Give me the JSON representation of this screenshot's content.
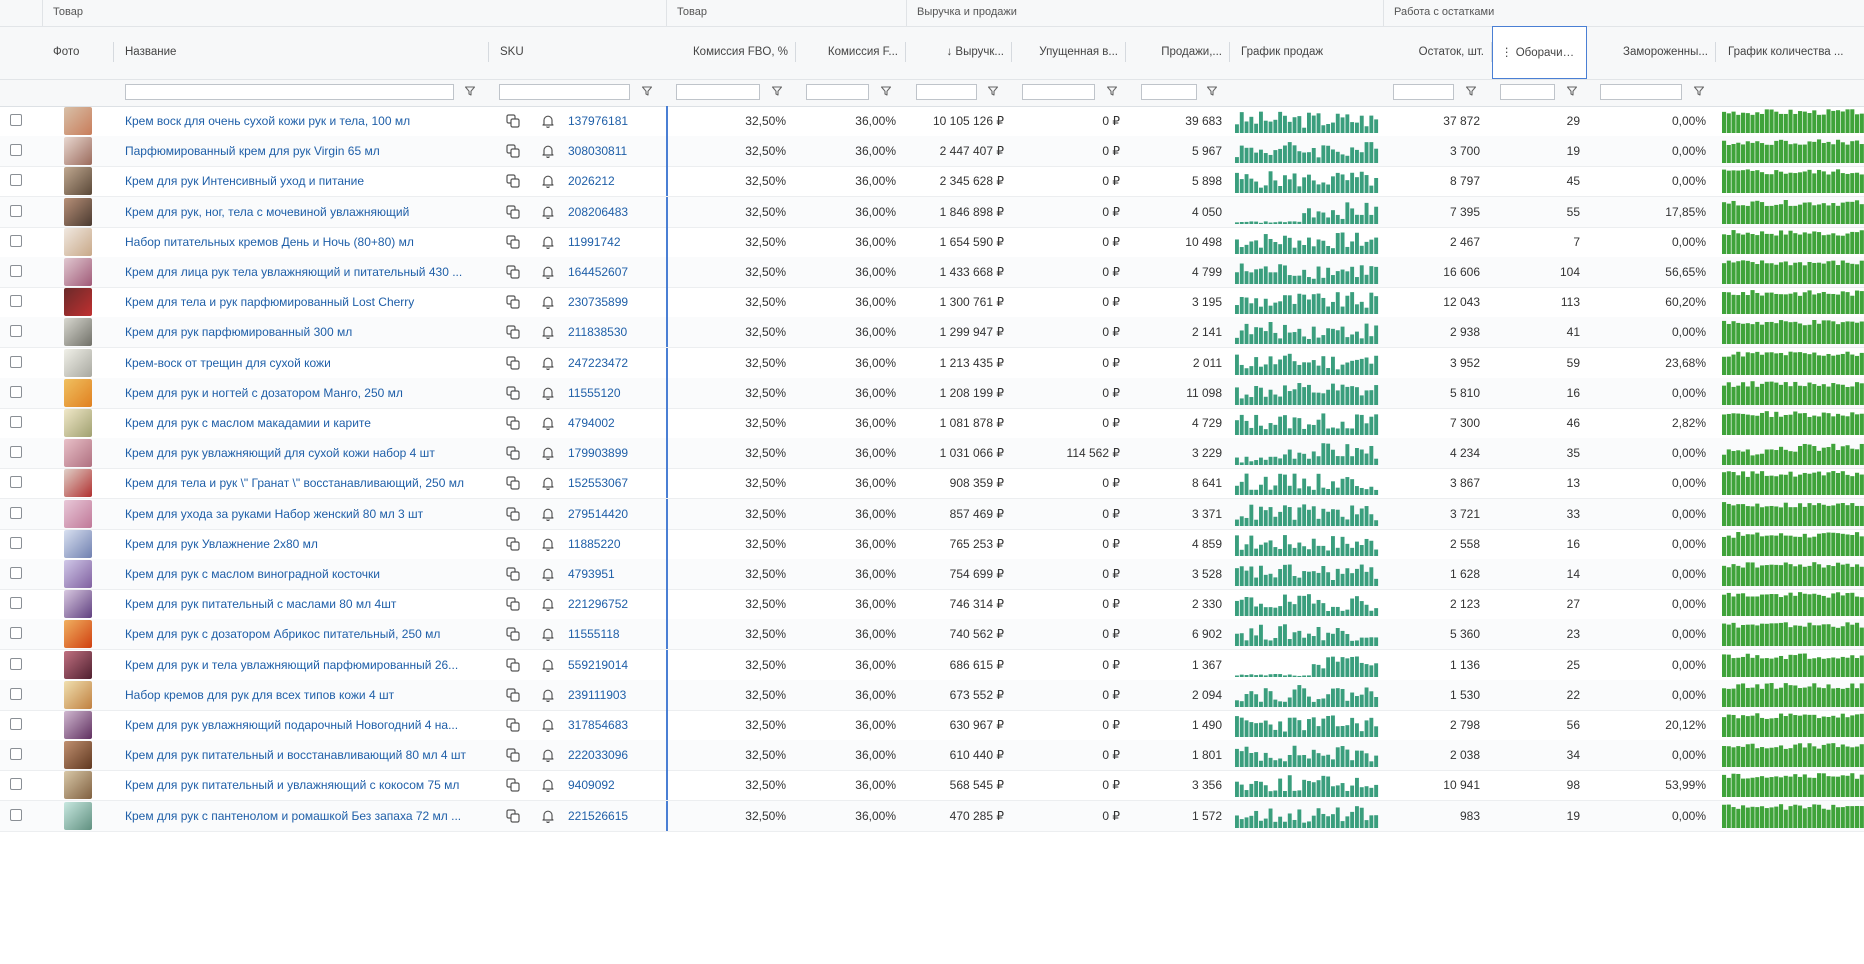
{
  "groups": [
    {
      "label": "Товар"
    },
    {
      "label": "Товар"
    },
    {
      "label": "Выручка и продажи"
    },
    {
      "label": "Работа с остатками"
    }
  ],
  "columns": {
    "photo": "Фото",
    "name": "Название",
    "sku": "SKU",
    "fbo": "Комиссия FBO, %",
    "fbs": "Комиссия F...",
    "revenue": "↓ Выручк...",
    "lost": "Упущенная в...",
    "sales": "Продажи,...",
    "sales_chart": "График продаж",
    "stock": "Остаток, шт.",
    "turnover": "⋮ Оборачив...",
    "frozen": "Замороженны...",
    "stock_chart": "График количества ..."
  },
  "colors": {
    "link": "#1f5fa8",
    "bar": "#3a9e7d",
    "stock_bar": "#3fa33a",
    "accent": "#4a7fd4"
  },
  "rows": [
    {
      "name": "Крем воск для очень сухой кожи рук и тела, 100 мл",
      "sku": "137976181",
      "fbo": "32,50%",
      "fbs": "36,00%",
      "revenue": "10 105 126 ₽",
      "lost": "0 ₽",
      "sales": "39 683",
      "stock": "37 872",
      "turnover": "29",
      "frozen": "0,00%"
    },
    {
      "name": "Парфюмированный крем для рук Virgin 65 мл",
      "sku": "308030811",
      "fbo": "32,50%",
      "fbs": "36,00%",
      "revenue": "2 447 407 ₽",
      "lost": "0 ₽",
      "sales": "5 967",
      "stock": "3 700",
      "turnover": "19",
      "frozen": "0,00%"
    },
    {
      "name": "Крем для рук Интенсивный уход и питание",
      "sku": "2026212",
      "fbo": "32,50%",
      "fbs": "36,00%",
      "revenue": "2 345 628 ₽",
      "lost": "0 ₽",
      "sales": "5 898",
      "stock": "8 797",
      "turnover": "45",
      "frozen": "0,00%"
    },
    {
      "name": "Крем для рук, ног, тела с мочевиной увлажняющий",
      "sku": "208206483",
      "fbo": "32,50%",
      "fbs": "36,00%",
      "revenue": "1 846 898 ₽",
      "lost": "0 ₽",
      "sales": "4 050",
      "stock": "7 395",
      "turnover": "55",
      "frozen": "17,85%"
    },
    {
      "name": "Набор питательных кремов День и Ночь (80+80) мл",
      "sku": "11991742",
      "fbo": "32,50%",
      "fbs": "36,00%",
      "revenue": "1 654 590 ₽",
      "lost": "0 ₽",
      "sales": "10 498",
      "stock": "2 467",
      "turnover": "7",
      "frozen": "0,00%"
    },
    {
      "name": "Крем для лица рук тела увлажняющий и питательный 430 ...",
      "sku": "164452607",
      "fbo": "32,50%",
      "fbs": "36,00%",
      "revenue": "1 433 668 ₽",
      "lost": "0 ₽",
      "sales": "4 799",
      "stock": "16 606",
      "turnover": "104",
      "frozen": "56,65%"
    },
    {
      "name": "Крем для тела и рук парфюмированный Lost Cherry",
      "sku": "230735899",
      "fbo": "32,50%",
      "fbs": "36,00%",
      "revenue": "1 300 761 ₽",
      "lost": "0 ₽",
      "sales": "3 195",
      "stock": "12 043",
      "turnover": "113",
      "frozen": "60,20%"
    },
    {
      "name": "Крем для рук парфюмированный 300 мл",
      "sku": "211838530",
      "fbo": "32,50%",
      "fbs": "36,00%",
      "revenue": "1 299 947 ₽",
      "lost": "0 ₽",
      "sales": "2 141",
      "stock": "2 938",
      "turnover": "41",
      "frozen": "0,00%"
    },
    {
      "name": "Крем-воск от трещин для сухой кожи",
      "sku": "247223472",
      "fbo": "32,50%",
      "fbs": "36,00%",
      "revenue": "1 213 435 ₽",
      "lost": "0 ₽",
      "sales": "2 011",
      "stock": "3 952",
      "turnover": "59",
      "frozen": "23,68%"
    },
    {
      "name": "Крем для рук и ногтей с дозатором Манго, 250 мл",
      "sku": "11555120",
      "fbo": "32,50%",
      "fbs": "36,00%",
      "revenue": "1 208 199 ₽",
      "lost": "0 ₽",
      "sales": "11 098",
      "stock": "5 810",
      "turnover": "16",
      "frozen": "0,00%"
    },
    {
      "name": "Крем для рук с маслом макадамии и карите",
      "sku": "4794002",
      "fbo": "32,50%",
      "fbs": "36,00%",
      "revenue": "1 081 878 ₽",
      "lost": "0 ₽",
      "sales": "4 729",
      "stock": "7 300",
      "turnover": "46",
      "frozen": "2,82%"
    },
    {
      "name": "Крем для рук увлажняющий для сухой кожи набор 4 шт",
      "sku": "179903899",
      "fbo": "32,50%",
      "fbs": "36,00%",
      "revenue": "1 031 066 ₽",
      "lost": "114 562 ₽",
      "sales": "3 229",
      "stock": "4 234",
      "turnover": "35",
      "frozen": "0,00%"
    },
    {
      "name": "Крем для тела и рук \\\" Гранат \\\" восстанавливающий, 250 мл",
      "sku": "152553067",
      "fbo": "32,50%",
      "fbs": "36,00%",
      "revenue": "908 359 ₽",
      "lost": "0 ₽",
      "sales": "8 641",
      "stock": "3 867",
      "turnover": "13",
      "frozen": "0,00%"
    },
    {
      "name": "Крем для ухода за руками Набор женский 80 мл 3 шт",
      "sku": "279514420",
      "fbo": "32,50%",
      "fbs": "36,00%",
      "revenue": "857 469 ₽",
      "lost": "0 ₽",
      "sales": "3 371",
      "stock": "3 721",
      "turnover": "33",
      "frozen": "0,00%"
    },
    {
      "name": "Крем для рук Увлажнение 2х80 мл",
      "sku": "11885220",
      "fbo": "32,50%",
      "fbs": "36,00%",
      "revenue": "765 253 ₽",
      "lost": "0 ₽",
      "sales": "4 859",
      "stock": "2 558",
      "turnover": "16",
      "frozen": "0,00%"
    },
    {
      "name": "Крем для рук с маслом виноградной косточки",
      "sku": "4793951",
      "fbo": "32,50%",
      "fbs": "36,00%",
      "revenue": "754 699 ₽",
      "lost": "0 ₽",
      "sales": "3 528",
      "stock": "1 628",
      "turnover": "14",
      "frozen": "0,00%"
    },
    {
      "name": "Крем для рук питательный с маслами 80 мл 4шт",
      "sku": "221296752",
      "fbo": "32,50%",
      "fbs": "36,00%",
      "revenue": "746 314 ₽",
      "lost": "0 ₽",
      "sales": "2 330",
      "stock": "2 123",
      "turnover": "27",
      "frozen": "0,00%"
    },
    {
      "name": "Крем для рук с дозатором Абрикос питательный, 250 мл",
      "sku": "11555118",
      "fbo": "32,50%",
      "fbs": "36,00%",
      "revenue": "740 562 ₽",
      "lost": "0 ₽",
      "sales": "6 902",
      "stock": "5 360",
      "turnover": "23",
      "frozen": "0,00%"
    },
    {
      "name": "Крем для рук и тела увлажняющий парфюмированный 26...",
      "sku": "559219014",
      "fbo": "32,50%",
      "fbs": "36,00%",
      "revenue": "686 615 ₽",
      "lost": "0 ₽",
      "sales": "1 367",
      "stock": "1 136",
      "turnover": "25",
      "frozen": "0,00%"
    },
    {
      "name": "Набор кремов для рук для всех типов кожи 4 шт",
      "sku": "239111903",
      "fbo": "32,50%",
      "fbs": "36,00%",
      "revenue": "673 552 ₽",
      "lost": "0 ₽",
      "sales": "2 094",
      "stock": "1 530",
      "turnover": "22",
      "frozen": "0,00%"
    },
    {
      "name": "Крем для рук увлажняющий подарочный Новогодний 4 на...",
      "sku": "317854683",
      "fbo": "32,50%",
      "fbs": "36,00%",
      "revenue": "630 967 ₽",
      "lost": "0 ₽",
      "sales": "1 490",
      "stock": "2 798",
      "turnover": "56",
      "frozen": "20,12%"
    },
    {
      "name": "Крем для рук питательный и восстанавливающий 80 мл 4 шт",
      "sku": "222033096",
      "fbo": "32,50%",
      "fbs": "36,00%",
      "revenue": "610 440 ₽",
      "lost": "0 ₽",
      "sales": "1 801",
      "stock": "2 038",
      "turnover": "34",
      "frozen": "0,00%"
    },
    {
      "name": "Крем для рук питательный и увлажняющий с кокосом 75 мл",
      "sku": "9409092",
      "fbo": "32,50%",
      "fbs": "36,00%",
      "revenue": "568 545 ₽",
      "lost": "0 ₽",
      "sales": "3 356",
      "stock": "10 941",
      "turnover": "98",
      "frozen": "53,99%"
    },
    {
      "name": "Крем для рук с пантенолом и ромашкой Без запаха 72 мл ...",
      "sku": "221526615",
      "fbo": "32,50%",
      "fbs": "36,00%",
      "revenue": "470 285 ₽",
      "lost": "0 ₽",
      "sales": "1 572",
      "stock": "983",
      "turnover": "19",
      "frozen": "0,00%"
    }
  ]
}
